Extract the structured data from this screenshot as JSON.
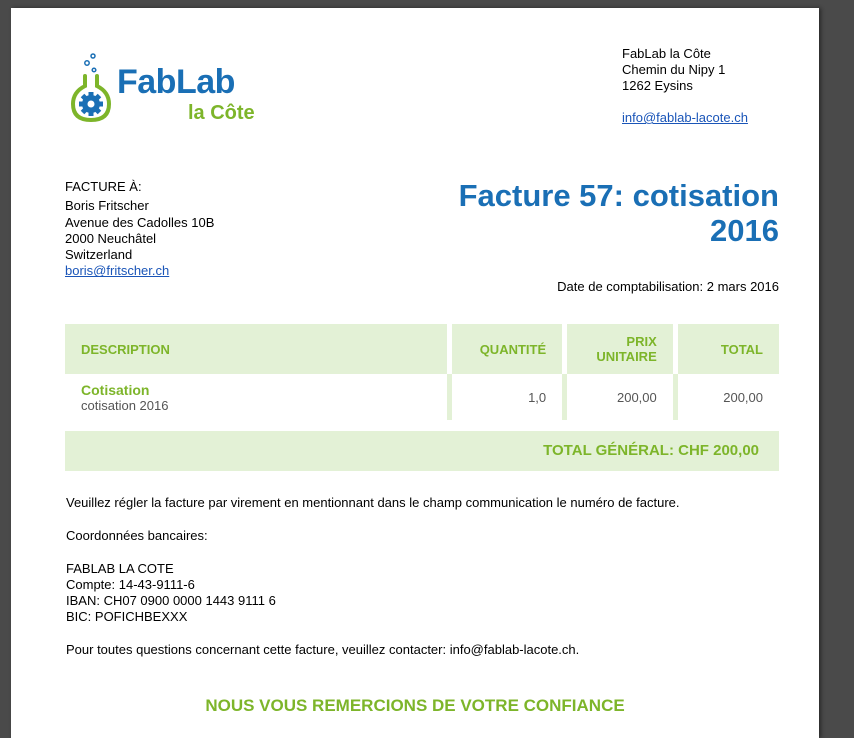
{
  "logo": {
    "word1": "FabLab",
    "word2": "la Côte"
  },
  "sender": {
    "name": "FabLab la Côte",
    "street": "Chemin du Nipy 1",
    "city": "1262 Eysins",
    "email": "info@fablab-lacote.ch"
  },
  "bill_to": {
    "label": "FACTURE À:",
    "name": "Boris Fritscher",
    "street": "Avenue des Cadolles 10B",
    "city": "2000 Neuchâtel",
    "country": "Switzerland",
    "email": "boris@fritscher.ch"
  },
  "invoice": {
    "title_line1": "Facture 57: cotisation",
    "title_line2": "2016",
    "date": "Date de comptabilisation: 2 mars 2016"
  },
  "table": {
    "headers": {
      "description": "DESCRIPTION",
      "quantity": "QUANTITÉ",
      "unit_price_1": "PRIX",
      "unit_price_2": "UNITAIRE",
      "total": "TOTAL"
    },
    "rows": [
      {
        "name": "Cotisation",
        "detail": "cotisation 2016",
        "quantity": "1,0",
        "unit_price": "200,00",
        "total": "200,00"
      }
    ]
  },
  "grand_total": "TOTAL GÉNÉRAL: CHF 200,00",
  "notes": {
    "payment": "Veuillez régler la facture par virement en mentionnant dans le champ communication le numéro de facture.",
    "bank_heading": "Coordonnées bancaires:",
    "bank_lines": [
      "FABLAB LA COTE",
      "Compte: 14-43-9111-6",
      "IBAN: CH07 0900 0000 1443 9111 6",
      "BIC: POFICHBEXXX"
    ],
    "contact": "Pour toutes questions concernant cette facture, veuillez contacter: info@fablab-lacote.ch."
  },
  "thanks": "NOUS VOUS REMERCIONS DE VOTRE CONFIANCE",
  "colors": {
    "brand_blue": "#1a6fb5",
    "brand_green": "#7db52a",
    "table_bg": "#e3f1d6",
    "link": "#1a55b8"
  }
}
